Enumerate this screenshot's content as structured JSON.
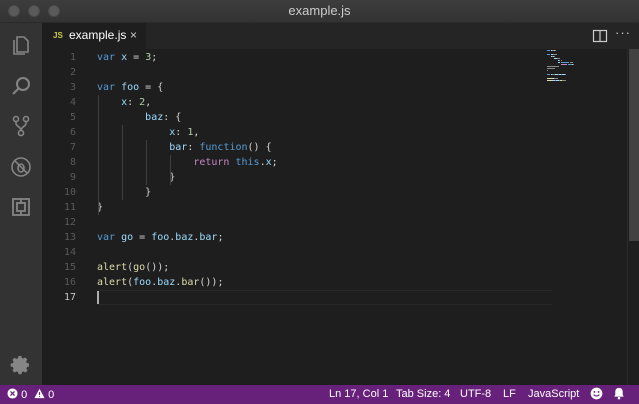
{
  "window": {
    "title": "example.js"
  },
  "tab": {
    "icon_text": "JS",
    "label": "example.js",
    "close_glyph": "×"
  },
  "toolbar": {
    "more_glyph": "···"
  },
  "line_numbers": [
    "1",
    "2",
    "3",
    "4",
    "5",
    "6",
    "7",
    "8",
    "9",
    "10",
    "11",
    "12",
    "13",
    "14",
    "15",
    "16",
    "17"
  ],
  "current_line": 17,
  "code_lines": [
    [
      {
        "t": "var",
        "c": "k"
      },
      {
        "t": " "
      },
      {
        "t": "x",
        "c": "v"
      },
      {
        "t": " = "
      },
      {
        "t": "3",
        "c": "n"
      },
      {
        "t": ";"
      }
    ],
    [],
    [
      {
        "t": "var",
        "c": "k"
      },
      {
        "t": " "
      },
      {
        "t": "foo",
        "c": "v"
      },
      {
        "t": " = {"
      }
    ],
    [
      {
        "t": "    "
      },
      {
        "t": "x",
        "c": "v"
      },
      {
        "t": ": "
      },
      {
        "t": "2",
        "c": "n"
      },
      {
        "t": ","
      }
    ],
    [
      {
        "t": "        "
      },
      {
        "t": "baz",
        "c": "v"
      },
      {
        "t": ": {"
      }
    ],
    [
      {
        "t": "            "
      },
      {
        "t": "x",
        "c": "v"
      },
      {
        "t": ": "
      },
      {
        "t": "1",
        "c": "n"
      },
      {
        "t": ","
      }
    ],
    [
      {
        "t": "            "
      },
      {
        "t": "bar",
        "c": "v"
      },
      {
        "t": ": "
      },
      {
        "t": "function",
        "c": "k"
      },
      {
        "t": "() {"
      }
    ],
    [
      {
        "t": "                "
      },
      {
        "t": "return",
        "c": "r"
      },
      {
        "t": " "
      },
      {
        "t": "this",
        "c": "k"
      },
      {
        "t": "."
      },
      {
        "t": "x",
        "c": "v"
      },
      {
        "t": ";"
      }
    ],
    [
      {
        "t": "            }"
      }
    ],
    [
      {
        "t": "        }"
      }
    ],
    [
      {
        "t": "}"
      }
    ],
    [],
    [
      {
        "t": "var",
        "c": "k"
      },
      {
        "t": " "
      },
      {
        "t": "go",
        "c": "v"
      },
      {
        "t": " = "
      },
      {
        "t": "foo",
        "c": "v"
      },
      {
        "t": "."
      },
      {
        "t": "baz",
        "c": "v"
      },
      {
        "t": "."
      },
      {
        "t": "bar",
        "c": "v"
      },
      {
        "t": ";"
      }
    ],
    [],
    [
      {
        "t": "alert",
        "c": "f"
      },
      {
        "t": "("
      },
      {
        "t": "go",
        "c": "f"
      },
      {
        "t": "());"
      }
    ],
    [
      {
        "t": "alert",
        "c": "f"
      },
      {
        "t": "("
      },
      {
        "t": "foo",
        "c": "v"
      },
      {
        "t": "."
      },
      {
        "t": "baz",
        "c": "v"
      },
      {
        "t": "."
      },
      {
        "t": "bar",
        "c": "f"
      },
      {
        "t": "());"
      }
    ],
    []
  ],
  "activity_icons": [
    "explorer-icon",
    "search-icon",
    "source-control-icon",
    "debug-icon",
    "extensions-icon"
  ],
  "statusbar": {
    "errors": "0",
    "warnings": "0",
    "position": "Ln 17, Col 1",
    "tab_size": "Tab Size: 4",
    "encoding": "UTF-8",
    "eol": "LF",
    "language": "JavaScript"
  },
  "colors": {
    "statusbar_bg": "#68217a",
    "editor_bg": "#1e1e1e",
    "keyword": "#569cd6",
    "variable": "#9cdcfe",
    "number": "#b5cea8",
    "function": "#dcdcaa",
    "control": "#c586c0"
  }
}
